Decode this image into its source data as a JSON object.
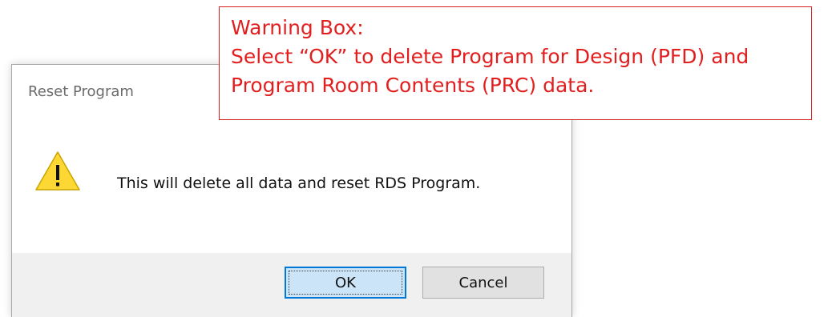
{
  "dialog": {
    "title": "Reset Program",
    "message": "This will delete all data and reset RDS Program.",
    "icon": "warning-icon",
    "buttons": {
      "ok_label": "OK",
      "cancel_label": "Cancel"
    }
  },
  "callout": {
    "heading": "Warning Box:",
    "line1": "Select “OK” to delete Program for Design (PFD) and",
    "line2": "Program Room Contents (PRC) data."
  },
  "colors": {
    "callout_text": "#e21f1f",
    "callout_border": "#d71e1e",
    "ok_button_fill": "#cce4f7",
    "ok_button_border": "#0078d7",
    "warning_fill": "#fdd835"
  }
}
